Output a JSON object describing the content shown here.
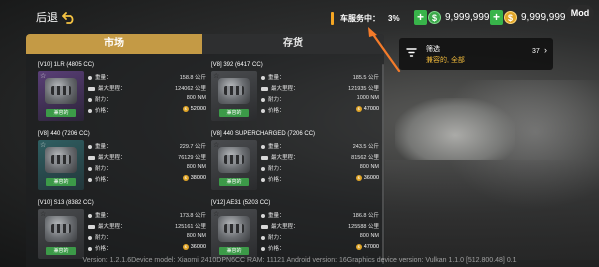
{
  "header": {
    "back_label": "后退",
    "service_label": "车服务中：",
    "service_value": "3%",
    "currency_green_value": "9,999,999",
    "currency_gold_value": "9,999,999",
    "currency_green_symbol": "$",
    "currency_gold_symbol": "$",
    "plus_label": "+",
    "mod_badge": "Mod",
    "accent_color": "#f5a623"
  },
  "tabs": [
    {
      "label": "市场",
      "active": true,
      "color": "#c49a45"
    },
    {
      "label": "存货",
      "active": false
    }
  ],
  "spec_labels": {
    "weight": "重量：",
    "mileage": "最大里程：",
    "torque": "耐力：",
    "price": "价格："
  },
  "engines": [
    {
      "title": "[V10] 1LR (4805 CC)",
      "weight": "158.8 公斤",
      "mileage": "124062 公里",
      "torque": "800 NM",
      "price": "52000",
      "compat": "兼容的",
      "fav": "☆"
    },
    {
      "title": "[V8] 392 (6417 CC)",
      "weight": "185.5 公斤",
      "mileage": "121935 公里",
      "torque": "1000 NM",
      "price": "47000",
      "compat": "兼容的",
      "fav": "☆"
    },
    {
      "title": "[V8] 440 (7206 CC)",
      "weight": "229.7 公斤",
      "mileage": "76129 公里",
      "torque": "800 NM",
      "price": "38000",
      "compat": "兼容的",
      "fav": "☆"
    },
    {
      "title": "[V8] 440 SUPERCHARGED (7206 CC)",
      "weight": "243.5 公斤",
      "mileage": "81562 公里",
      "torque": "800 NM",
      "price": "36000",
      "compat": "兼容的",
      "fav": "☆"
    },
    {
      "title": "[V10] S13 (8382 CC)",
      "weight": "173.8 公斤",
      "mileage": "125161 公里",
      "torque": "800 NM",
      "price": "36000",
      "compat": "兼容的",
      "fav": "☆"
    },
    {
      "title": "[V12] AE31 (5203 CC)",
      "weight": "186.8 公斤",
      "mileage": "125588 公里",
      "torque": "800 NM",
      "price": "47000",
      "compat": "兼容的",
      "fav": "☆"
    }
  ],
  "filter": {
    "label": "筛选",
    "value": "兼容的, 全部",
    "count": "37",
    "chevron": "›"
  },
  "footer": {
    "version": "Version: 1.2.1.6Device model: Xiaomi 2410DPN6CC RAM: 11121 Android version: 16Graphics device version: Vulkan 1.1.0 [512.800.48] 0.1"
  }
}
